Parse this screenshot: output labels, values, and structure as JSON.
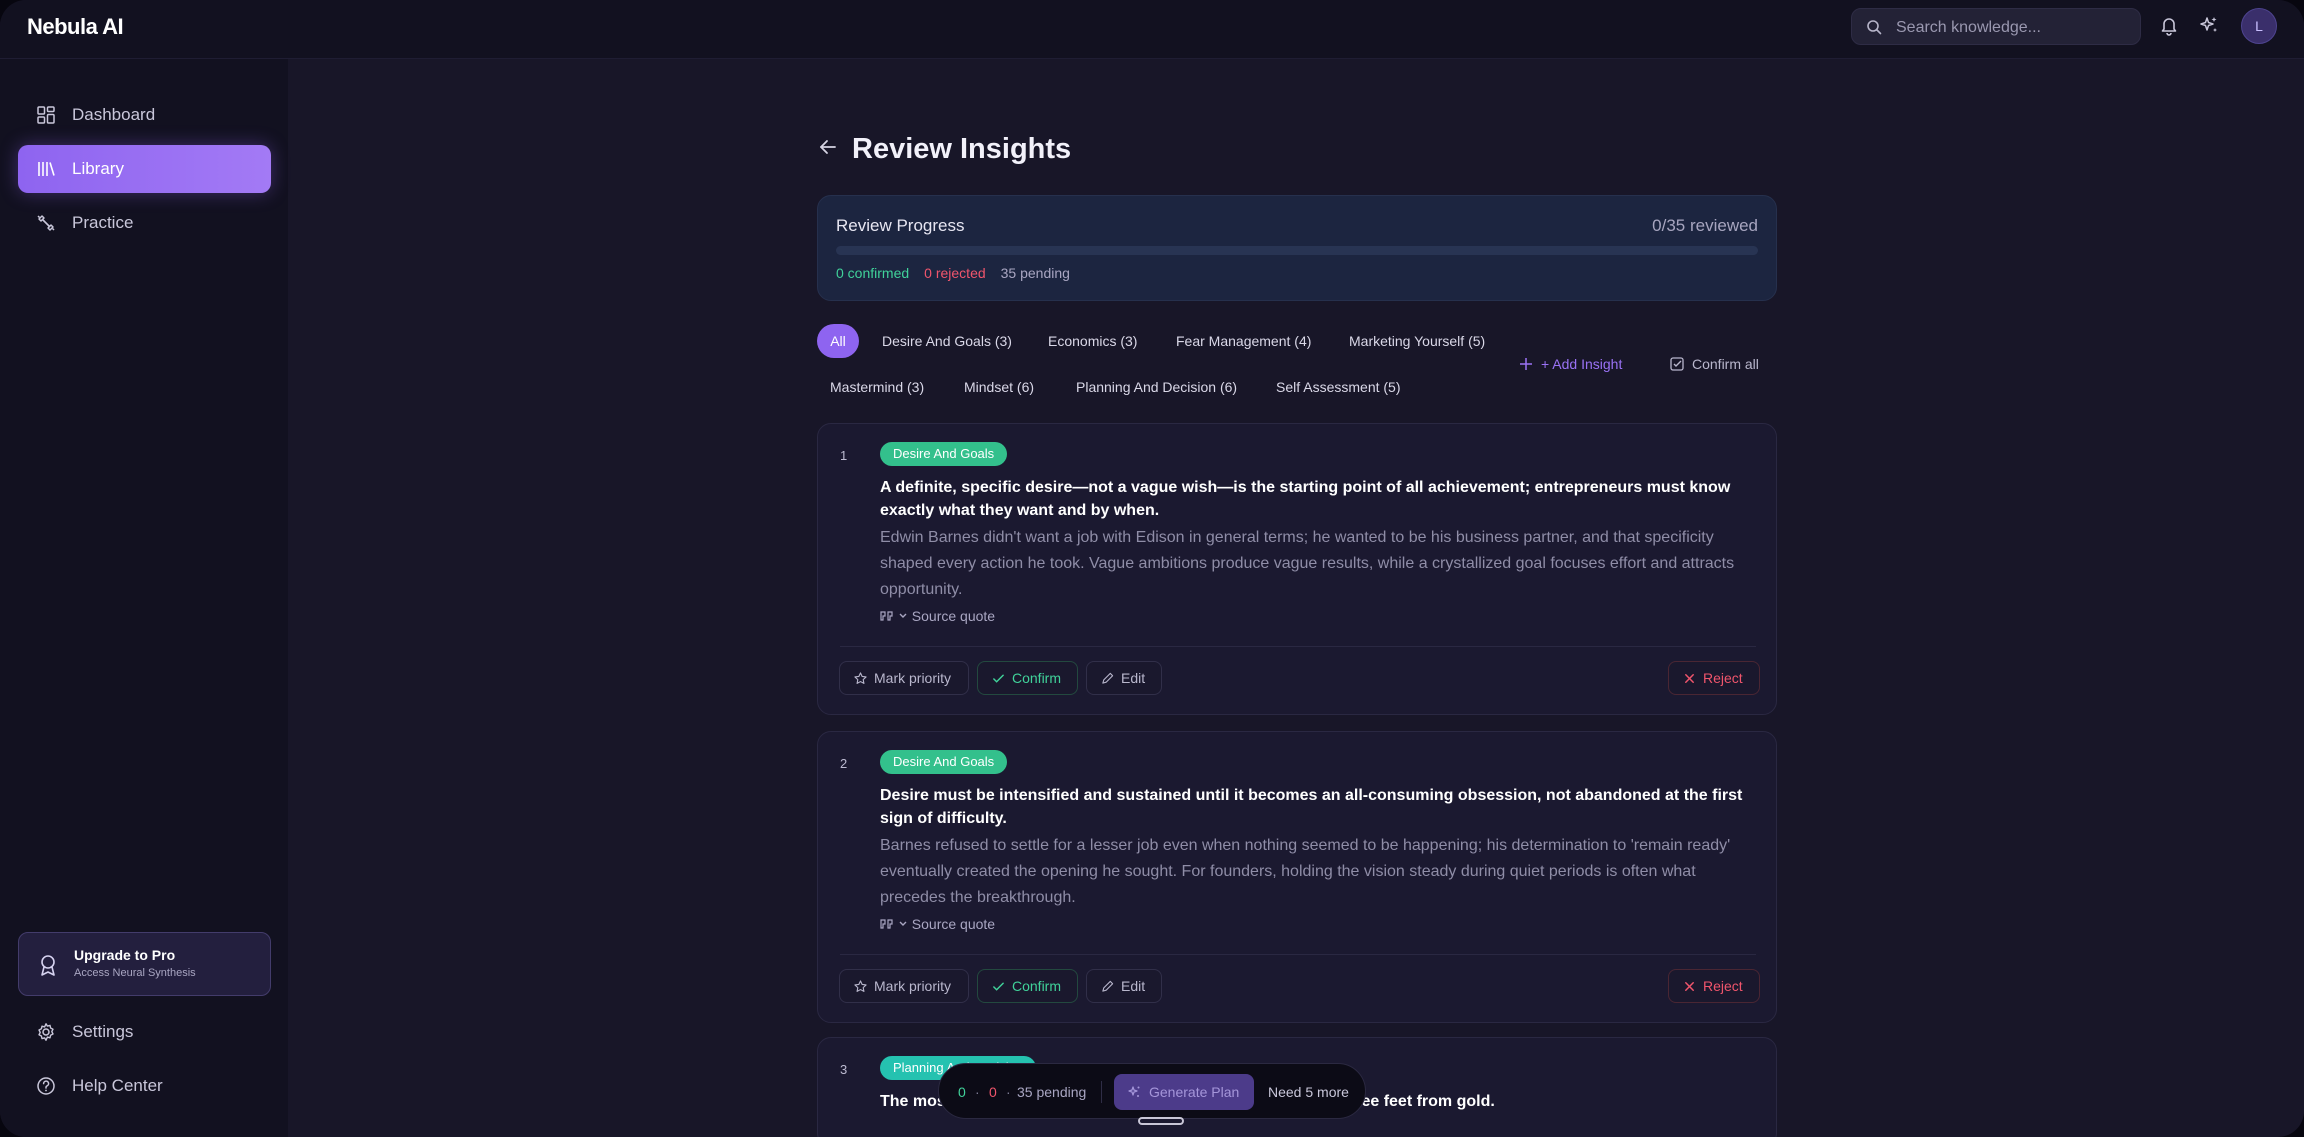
{
  "app": {
    "name": "Nebula AI"
  },
  "search": {
    "placeholder": "Search knowledge..."
  },
  "user": {
    "initial": "L"
  },
  "sidebar": {
    "items": [
      {
        "label": "Dashboard",
        "icon": "grid-icon"
      },
      {
        "label": "Library",
        "icon": "library-icon"
      },
      {
        "label": "Practice",
        "icon": "dumbbell-icon"
      }
    ],
    "upgrade": {
      "title": "Upgrade to Pro",
      "subtitle": "Access Neural Synthesis"
    },
    "bottom": [
      {
        "label": "Settings",
        "icon": "gear-icon"
      },
      {
        "label": "Help Center",
        "icon": "help-circle-icon"
      }
    ]
  },
  "page": {
    "title": "Review Insights"
  },
  "progress": {
    "title": "Review Progress",
    "reviewed_text": "0/35 reviewed",
    "fraction": 0,
    "confirmed": "0 confirmed",
    "rejected": "0 rejected",
    "pending": "35 pending"
  },
  "filters": [
    "All",
    "Desire And Goals (3)",
    "Economics (3)",
    "Fear Management (4)",
    "Marketing Yourself (5)",
    "Mastermind (3)",
    "Mindset (6)",
    "Planning And Decision (6)",
    "Self Assessment (5)"
  ],
  "actions": {
    "add": "+ Add Insight",
    "confirm_all": "Confirm all"
  },
  "insights": [
    {
      "number": "1",
      "tag": "Desire And Goals",
      "title": "A definite, specific desire—not a vague wish—is the starting point of all achievement; entrepreneurs must know exactly what they want and by when.",
      "body": "Edwin Barnes didn't want a job with Edison in general terms; he wanted to be his business partner, and that specificity shaped every action he took. Vague ambitions produce vague results, while a crystallized goal focuses effort and attracts opportunity.",
      "source": "Source quote"
    },
    {
      "number": "2",
      "tag": "Desire And Goals",
      "title": "Desire must be intensified and sustained until it becomes an all-consuming obsession, not abandoned at the first sign of difficulty.",
      "body": "Barnes refused to settle for a lesser job even when nothing seemed to be happening; his determination to 'remain ready' eventually created the opening he sought. For founders, holding the vision steady during quiet periods is often what precedes the breakthrough.",
      "source": "Source quote"
    },
    {
      "number": "3",
      "tag": "Planning And Decision",
      "title": "The mos… eakthrough—know when 'no' or a setback is just three feet from gold."
    }
  ],
  "card_buttons": {
    "priority": "Mark priority",
    "confirm": "Confirm",
    "edit": "Edit",
    "reject": "Reject"
  },
  "floating": {
    "confirmed": "0",
    "rejected": "0",
    "pending": "35 pending",
    "generate": "Generate Plan",
    "need": "Need 5 more"
  },
  "colors": {
    "accent": "#8e64f0",
    "confirm": "#40d29a",
    "reject": "#f0556c",
    "tag_green": "#33c08c",
    "tag_teal": "#25c2b0"
  }
}
